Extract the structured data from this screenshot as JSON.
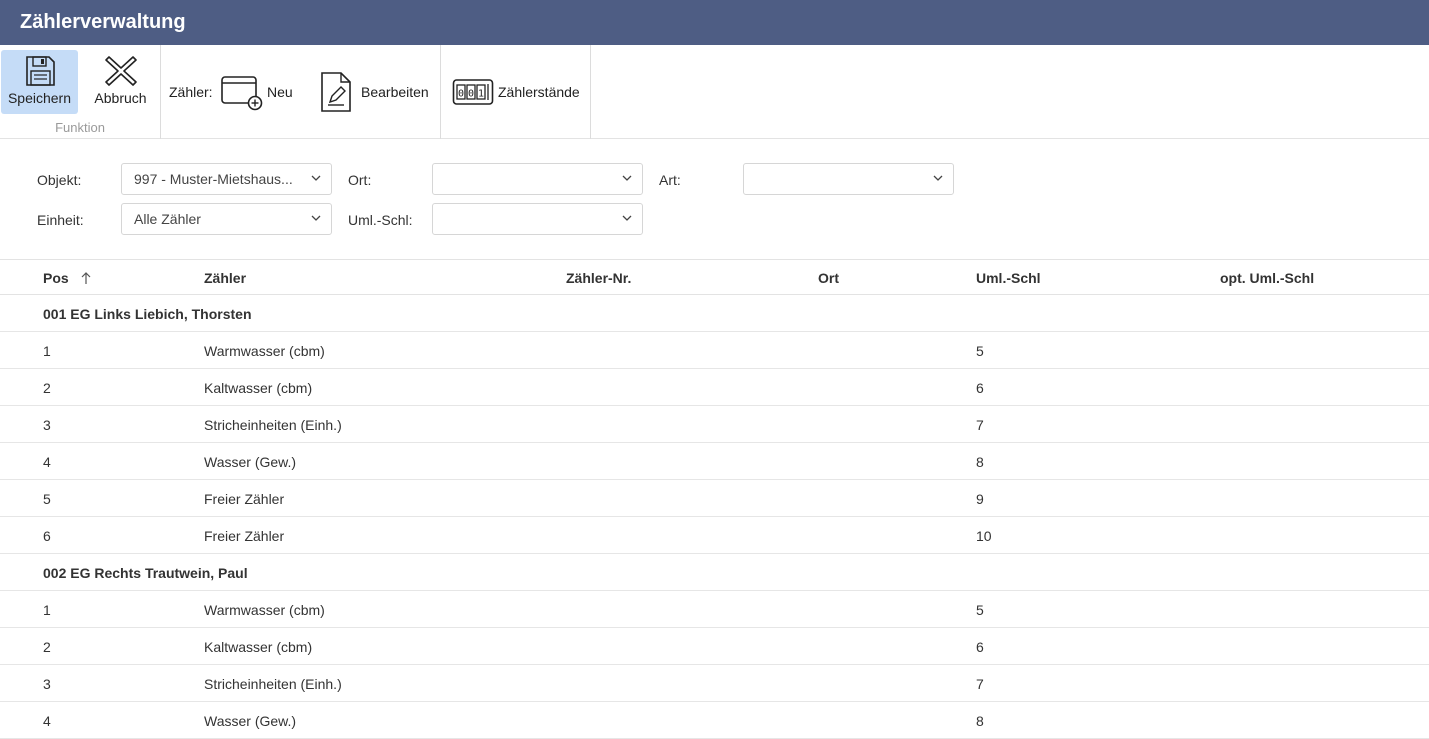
{
  "app": {
    "title": "Zählerverwaltung"
  },
  "ribbon": {
    "save_label": "Speichern",
    "cancel_label": "Abbruch",
    "group_function_label": "Funktion",
    "counter_label": "Zähler:",
    "new_label": "Neu",
    "edit_label": "Bearbeiten",
    "readings_label": "Zählerstände"
  },
  "filters": {
    "objekt_label": "Objekt:",
    "objekt_value": "997 - Muster-Mietshaus...",
    "ort_label": "Ort:",
    "ort_value": "",
    "art_label": "Art:",
    "art_value": "",
    "einheit_label": "Einheit:",
    "einheit_value": "Alle Zähler",
    "uml_label": "Uml.-Schl:",
    "uml_value": ""
  },
  "table": {
    "columns": {
      "pos": "Pos",
      "counter": "Zähler",
      "counter_no": "Zähler-Nr.",
      "location": "Ort",
      "uml": "Uml.-Schl",
      "opt_uml": "opt. Uml.-Schl"
    },
    "rows": [
      {
        "group": "001 EG Links Liebich, Thorsten"
      },
      {
        "pos": "1",
        "counter": "Warmwasser (cbm)",
        "uml": "5"
      },
      {
        "pos": "2",
        "counter": "Kaltwasser (cbm)",
        "uml": "6"
      },
      {
        "pos": "3",
        "counter": "Stricheinheiten (Einh.)",
        "uml": "7"
      },
      {
        "pos": "4",
        "counter": "Wasser (Gew.)",
        "uml": "8"
      },
      {
        "pos": "5",
        "counter": "Freier Zähler",
        "uml": "9"
      },
      {
        "pos": "6",
        "counter": "Freier Zähler",
        "uml": "10"
      },
      {
        "group": "002 EG Rechts Trautwein, Paul"
      },
      {
        "pos": "1",
        "counter": "Warmwasser (cbm)",
        "uml": "5"
      },
      {
        "pos": "2",
        "counter": "Kaltwasser (cbm)",
        "uml": "6"
      },
      {
        "pos": "3",
        "counter": "Stricheinheiten (Einh.)",
        "uml": "7"
      },
      {
        "pos": "4",
        "counter": "Wasser (Gew.)",
        "uml": "8"
      }
    ]
  },
  "colors": {
    "titlebar": "#4e5d84",
    "active_button": "#c5dcf7"
  },
  "icons": [
    "floppy-disk-icon",
    "close-x-icon",
    "window-add-icon",
    "document-edit-icon",
    "counter-digits-icon",
    "chevron-down-icon",
    "sort-up-arrow-icon"
  ]
}
